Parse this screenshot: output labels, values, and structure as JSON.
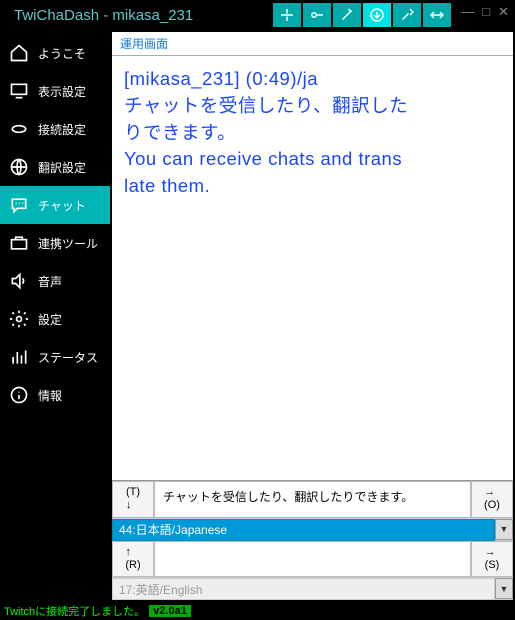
{
  "title": "TwiChaDash - mikasa_231",
  "winctrl": {
    "min": "—",
    "max": "□",
    "close": "✕"
  },
  "sidebar": {
    "items": [
      {
        "label": "ようこそ"
      },
      {
        "label": "表示設定"
      },
      {
        "label": "接続設定"
      },
      {
        "label": "翻訳設定"
      },
      {
        "label": "チャット"
      },
      {
        "label": "連携ツール"
      },
      {
        "label": "音声"
      },
      {
        "label": "設定"
      },
      {
        "label": "ステータス"
      },
      {
        "label": "情報"
      }
    ]
  },
  "tab": {
    "label": "運用画面"
  },
  "chat": {
    "line1": "[mikasa_231] (0:49)/ja",
    "line2": "チャットを受信したり、翻訳した",
    "line3": "りできます。",
    "line4": "You can receive chats and trans",
    "line5": "late them."
  },
  "input": {
    "top_left": "(T)\n↓",
    "top_text": "チャットを受信したり、翻訳したりできます。",
    "top_right": "→\n(O)",
    "lang1": "44:日本語/Japanese",
    "bot_left": "↑\n(R)",
    "bot_text": "",
    "bot_right": "→\n(S)",
    "lang2": "17:英語/English"
  },
  "status": {
    "text": "Twitchに接続完了しました。",
    "version": "v2.0a1"
  }
}
